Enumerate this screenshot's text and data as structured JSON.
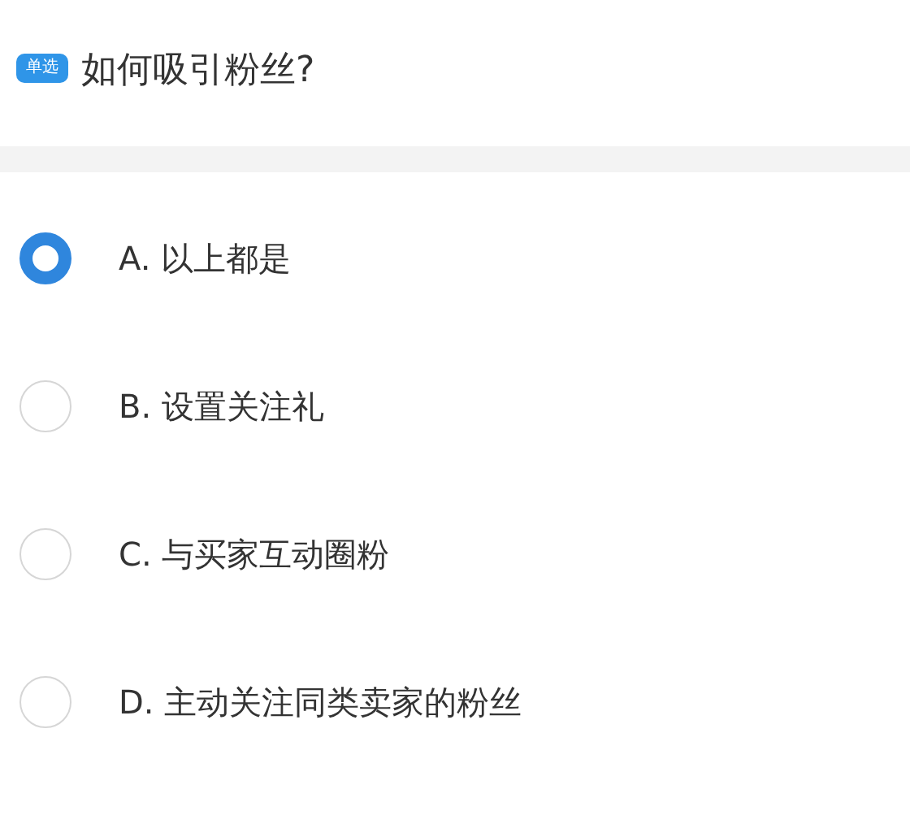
{
  "question": {
    "badge": "单选",
    "text": "如何吸引粉丝?"
  },
  "options": [
    {
      "label": "A. 以上都是",
      "selected": true
    },
    {
      "label": "B. 设置关注礼",
      "selected": false
    },
    {
      "label": "C. 与买家互动圈粉",
      "selected": false
    },
    {
      "label": "D. 主动关注同类卖家的粉丝",
      "selected": false
    }
  ]
}
